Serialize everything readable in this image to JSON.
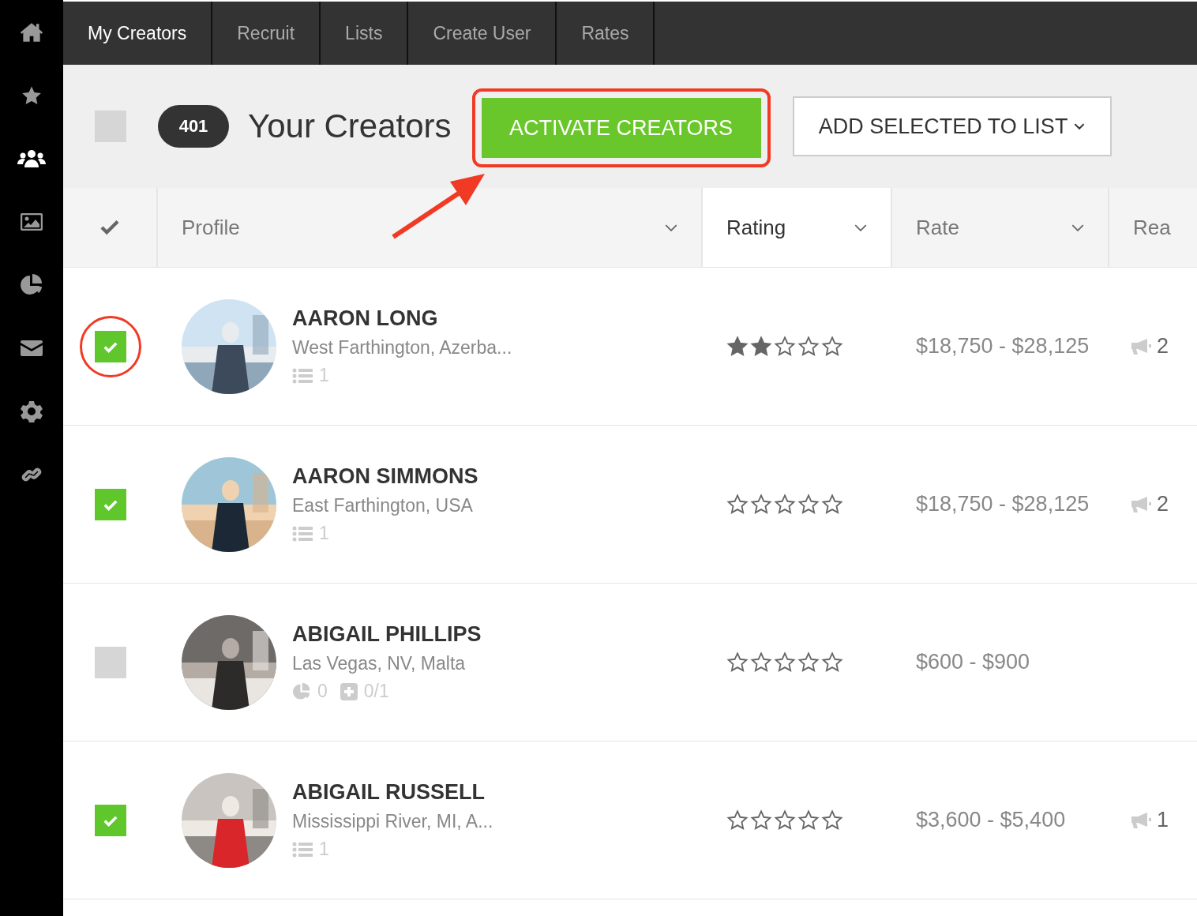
{
  "sidebar": {
    "items": [
      {
        "selected": false
      },
      {
        "selected": false
      },
      {
        "selected": true
      },
      {
        "selected": false
      },
      {
        "selected": false
      },
      {
        "selected": false
      },
      {
        "selected": false
      },
      {
        "selected": false
      }
    ]
  },
  "tabs": [
    {
      "label": "My Creators",
      "selected": true
    },
    {
      "label": "Recruit",
      "selected": false
    },
    {
      "label": "Lists",
      "selected": false
    },
    {
      "label": "Create User",
      "selected": false
    },
    {
      "label": "Rates",
      "selected": false
    }
  ],
  "header": {
    "select_all": {
      "checked": false
    },
    "count": "401",
    "title": "Your Creators",
    "activate_button": "ACTIVATE CREATORS",
    "list_button": "ADD SELECTED TO LIST"
  },
  "columns": [
    {
      "kind": "check",
      "selected": false
    },
    {
      "kind": "sort",
      "label": "Profile",
      "selected": false
    },
    {
      "kind": "sort",
      "label": "Rating",
      "selected": true
    },
    {
      "kind": "sort",
      "label": "Rate",
      "selected": false
    },
    {
      "kind": "plain",
      "label": "Rea",
      "selected": false
    }
  ],
  "rows": [
    {
      "checked": true,
      "highlighted": true,
      "name": "AARON LONG",
      "location": "West Farthington, Azerba...",
      "meta": {
        "kind": "lists",
        "count": "1"
      },
      "stars": 2,
      "rate": "$18,750 - $28,125",
      "reach": "2"
    },
    {
      "checked": true,
      "highlighted": false,
      "name": "AARON SIMMONS",
      "location": "East Farthington, USA",
      "meta": {
        "kind": "lists",
        "count": "1"
      },
      "stars": 0,
      "rate": "$18,750 - $28,125",
      "reach": "2"
    },
    {
      "checked": false,
      "highlighted": false,
      "name": "ABIGAIL PHILLIPS",
      "location": "Las Vegas, NV, Malta",
      "meta": {
        "kind": "stats",
        "count": "0",
        "ratio": "0/1"
      },
      "stars": 0,
      "rate": "$600 - $900"
    },
    {
      "checked": true,
      "highlighted": false,
      "name": "ABIGAIL RUSSELL",
      "location": "Mississippi River, MI, A...",
      "meta": {
        "kind": "lists",
        "count": "1"
      },
      "stars": 0,
      "rate": "$3,600 - $5,400",
      "reach": "1"
    }
  ]
}
